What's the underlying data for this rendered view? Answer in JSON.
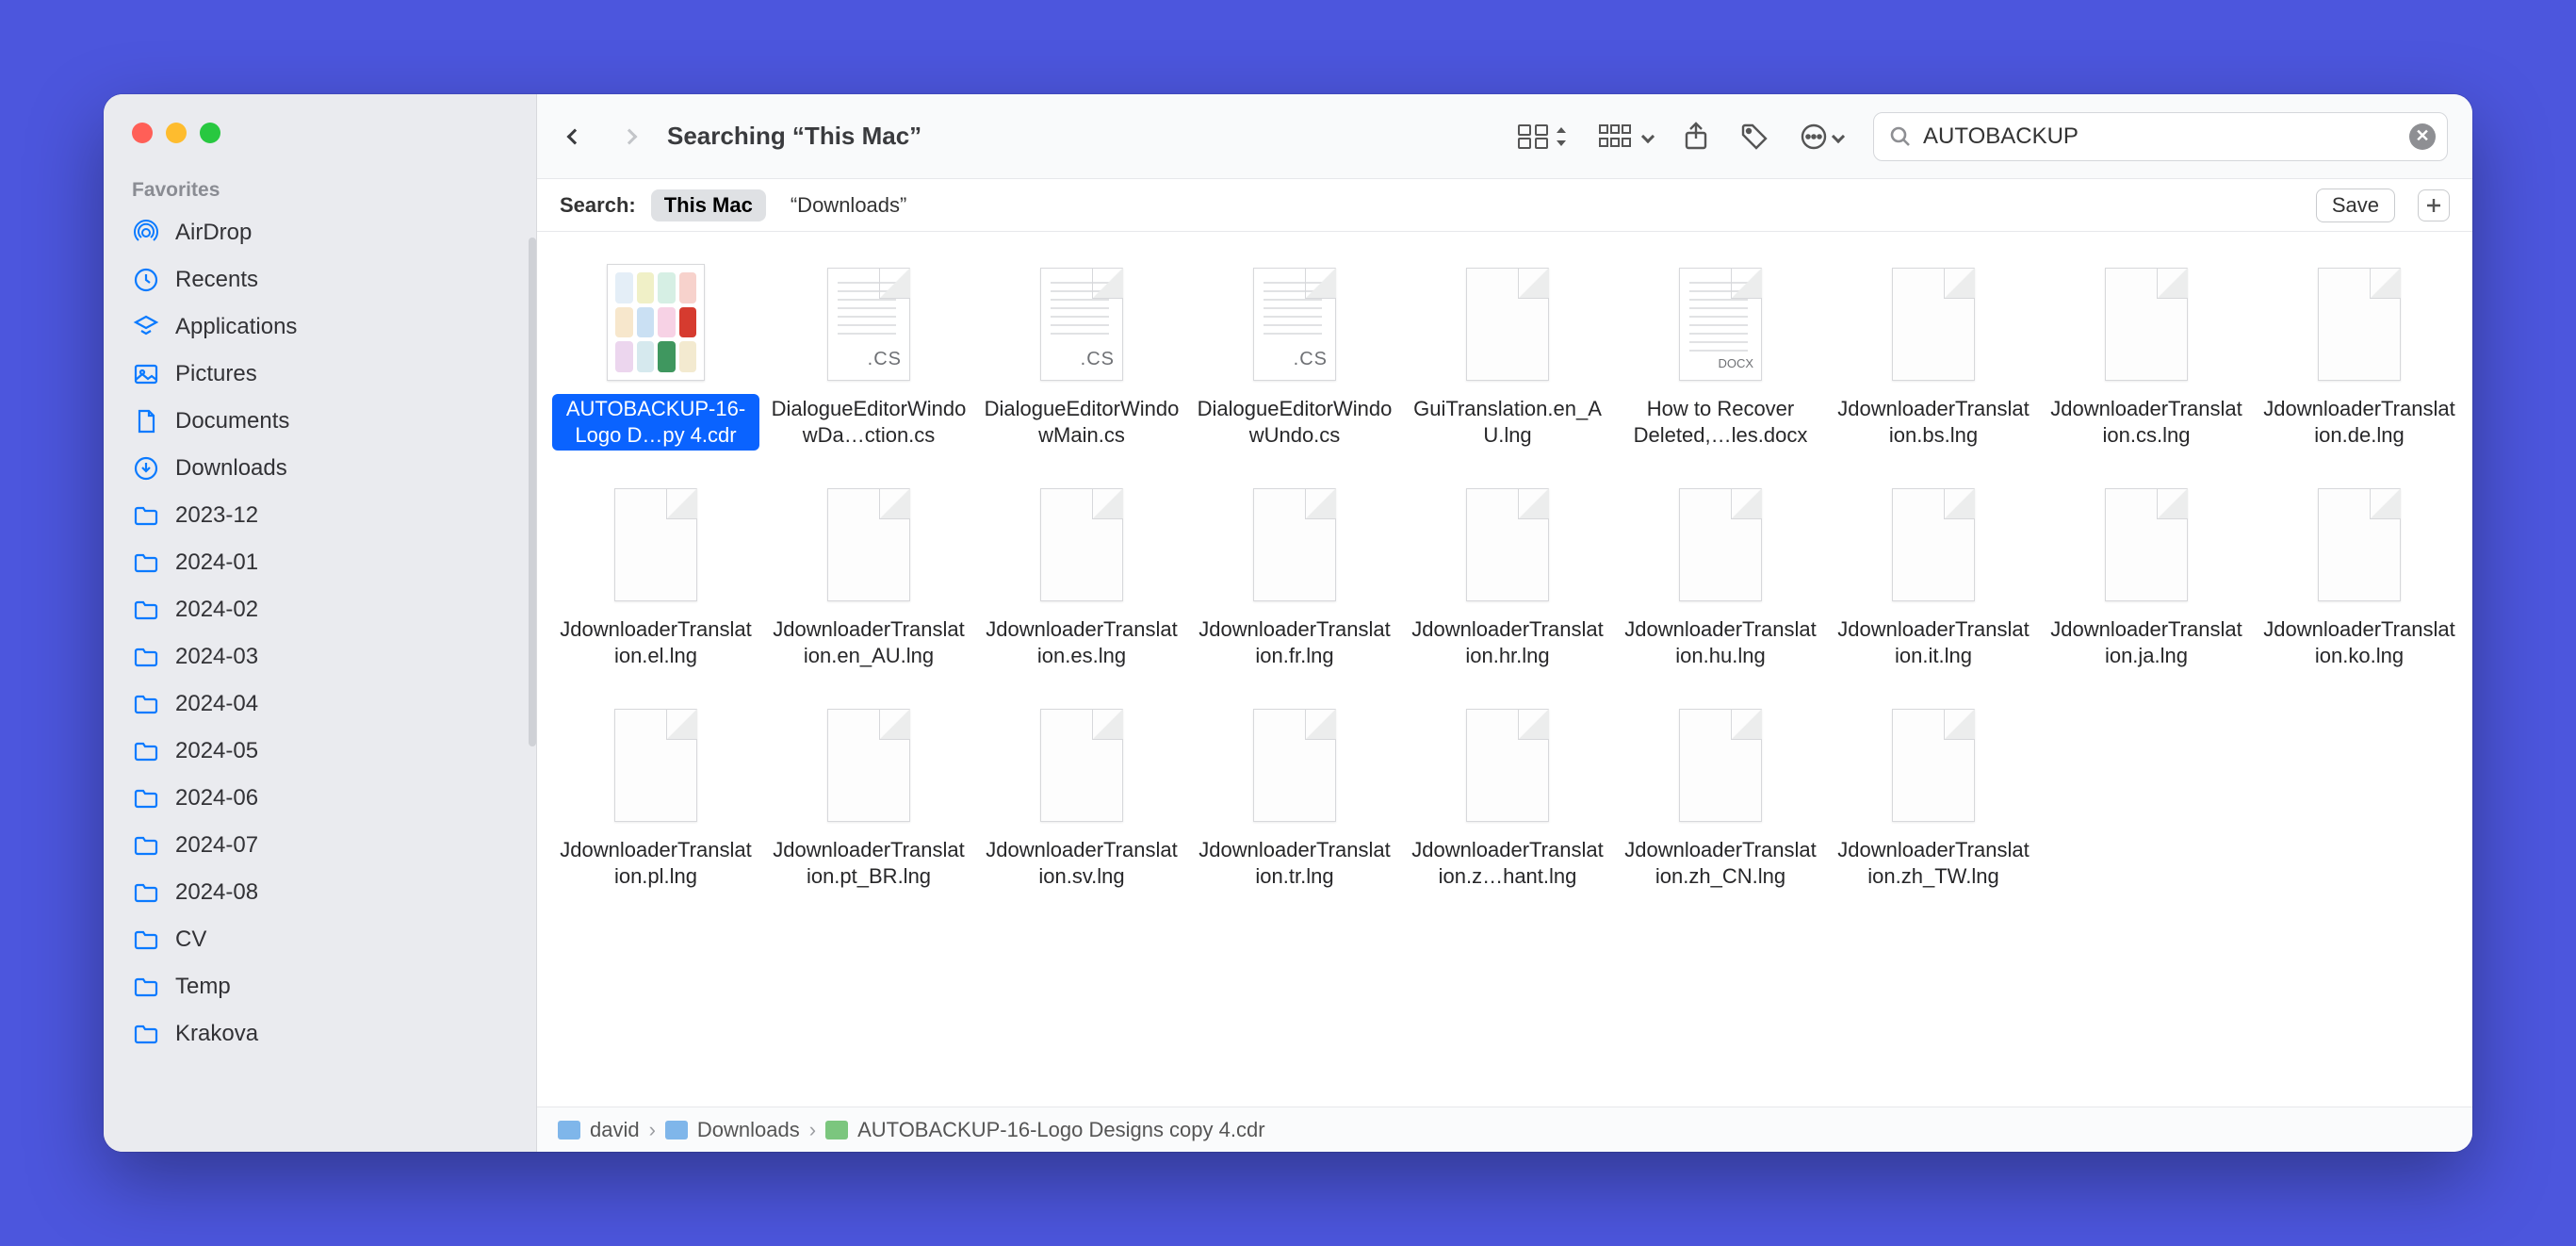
{
  "window": {
    "title": "Searching “This Mac”"
  },
  "sidebar": {
    "section": "Favorites",
    "items": [
      {
        "label": "AirDrop",
        "icon": "airdrop"
      },
      {
        "label": "Recents",
        "icon": "clock"
      },
      {
        "label": "Applications",
        "icon": "apps"
      },
      {
        "label": "Pictures",
        "icon": "pictures"
      },
      {
        "label": "Documents",
        "icon": "document"
      },
      {
        "label": "Downloads",
        "icon": "download"
      },
      {
        "label": "2023-12",
        "icon": "folder"
      },
      {
        "label": "2024-01",
        "icon": "folder"
      },
      {
        "label": "2024-02",
        "icon": "folder"
      },
      {
        "label": "2024-03",
        "icon": "folder"
      },
      {
        "label": "2024-04",
        "icon": "folder"
      },
      {
        "label": "2024-05",
        "icon": "folder"
      },
      {
        "label": "2024-06",
        "icon": "folder"
      },
      {
        "label": "2024-07",
        "icon": "folder"
      },
      {
        "label": "2024-08",
        "icon": "folder"
      },
      {
        "label": "CV",
        "icon": "folder"
      },
      {
        "label": "Temp",
        "icon": "folder"
      },
      {
        "label": "Krakova",
        "icon": "folder"
      }
    ]
  },
  "scope": {
    "label": "Search:",
    "active": "This Mac",
    "other": "“Downloads”",
    "save": "Save"
  },
  "search": {
    "value": "AUTOBACKUP"
  },
  "files": [
    {
      "name": "AUTOBACKUP-16-Logo D…py 4.cdr",
      "kind": "cdr",
      "selected": true
    },
    {
      "name": "DialogueEditorWindowDa…ction.cs",
      "kind": "cs"
    },
    {
      "name": "DialogueEditorWindowMain.cs",
      "kind": "cs"
    },
    {
      "name": "DialogueEditorWindowUndo.cs",
      "kind": "cs"
    },
    {
      "name": "GuiTranslation.en_AU.lng",
      "kind": "generic"
    },
    {
      "name": "How to Recover Deleted,…les.docx",
      "kind": "docx"
    },
    {
      "name": "JdownloaderTranslation.bs.lng",
      "kind": "generic"
    },
    {
      "name": "JdownloaderTranslation.cs.lng",
      "kind": "generic"
    },
    {
      "name": "JdownloaderTranslation.de.lng",
      "kind": "generic"
    },
    {
      "name": "JdownloaderTranslation.el.lng",
      "kind": "generic"
    },
    {
      "name": "JdownloaderTranslation.en_AU.lng",
      "kind": "generic"
    },
    {
      "name": "JdownloaderTranslation.es.lng",
      "kind": "generic"
    },
    {
      "name": "JdownloaderTranslation.fr.lng",
      "kind": "generic"
    },
    {
      "name": "JdownloaderTranslation.hr.lng",
      "kind": "generic"
    },
    {
      "name": "JdownloaderTranslation.hu.lng",
      "kind": "generic"
    },
    {
      "name": "JdownloaderTranslation.it.lng",
      "kind": "generic"
    },
    {
      "name": "JdownloaderTranslation.ja.lng",
      "kind": "generic"
    },
    {
      "name": "JdownloaderTranslation.ko.lng",
      "kind": "generic"
    },
    {
      "name": "JdownloaderTranslation.pl.lng",
      "kind": "generic"
    },
    {
      "name": "JdownloaderTranslation.pt_BR.lng",
      "kind": "generic"
    },
    {
      "name": "JdownloaderTranslation.sv.lng",
      "kind": "generic"
    },
    {
      "name": "JdownloaderTranslation.tr.lng",
      "kind": "generic"
    },
    {
      "name": "JdownloaderTranslation.z…hant.lng",
      "kind": "generic"
    },
    {
      "name": "JdownloaderTranslation.zh_CN.lng",
      "kind": "generic"
    },
    {
      "name": "JdownloaderTranslation.zh_TW.lng",
      "kind": "generic"
    }
  ],
  "pathbar": {
    "segments": [
      {
        "label": "david",
        "icon": "folder"
      },
      {
        "label": "Downloads",
        "icon": "folder2"
      },
      {
        "label": "AUTOBACKUP-16-Logo Designs copy 4.cdr",
        "icon": "doc"
      }
    ]
  },
  "colors": {
    "accent": "#0a63ff",
    "sidebar_icon": "#0a7aff"
  }
}
